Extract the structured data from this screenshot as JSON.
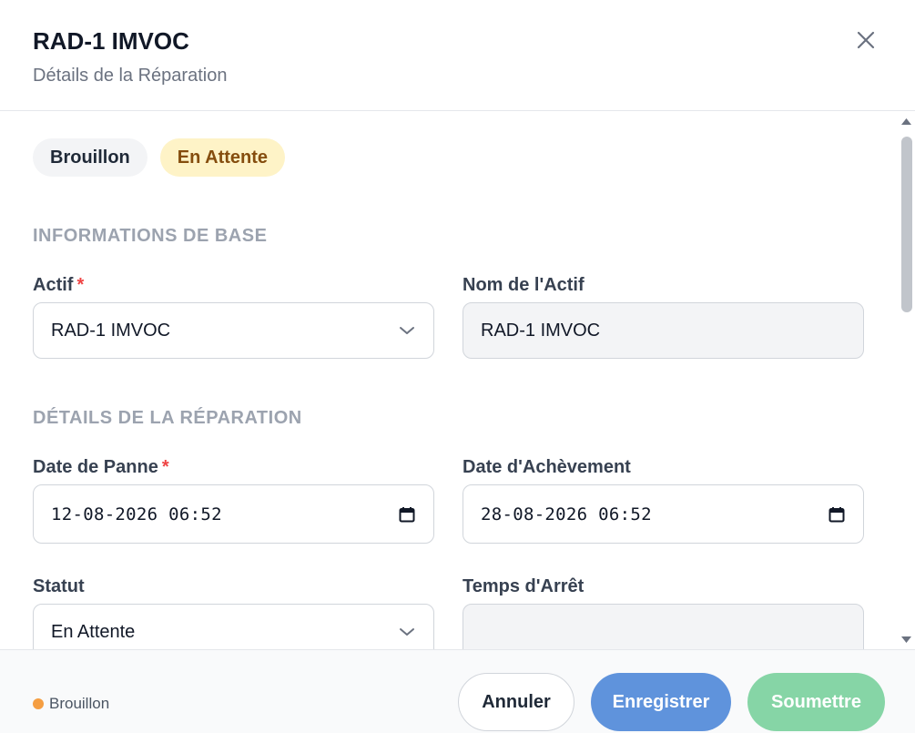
{
  "header": {
    "title": "RAD-1 IMVOC",
    "subtitle": "Détails de la Réparation",
    "close_icon": "close-icon"
  },
  "badges": {
    "draft": "Brouillon",
    "pending": "En Attente"
  },
  "sections": {
    "basic": "INFORMATIONS DE BASE",
    "repair": "DÉTAILS DE LA RÉPARATION"
  },
  "form": {
    "asset": {
      "label": "Actif",
      "required": "*",
      "value": "RAD-1 IMVOC"
    },
    "asset_name": {
      "label": "Nom de l'Actif",
      "value": "RAD-1 IMVOC"
    },
    "breakdown_date": {
      "label": "Date de Panne",
      "required": "*",
      "value": "12-08-2026 06:52"
    },
    "completion_date": {
      "label": "Date d'Achèvement",
      "value": "28-08-2026 06:52"
    },
    "status": {
      "label": "Statut",
      "value": "En Attente"
    },
    "downtime": {
      "label": "Temps d'Arrêt",
      "value": ""
    }
  },
  "footer": {
    "status": "Brouillon",
    "cancel": "Annuler",
    "save": "Enregistrer",
    "submit": "Soumettre"
  },
  "colors": {
    "save_button": "#5f93dc",
    "submit_button": "#86d5a6",
    "pending_badge_bg": "#fef3c7",
    "pending_badge_text": "#854d0e",
    "required": "#ef4444",
    "status_dot": "#f59e42"
  }
}
